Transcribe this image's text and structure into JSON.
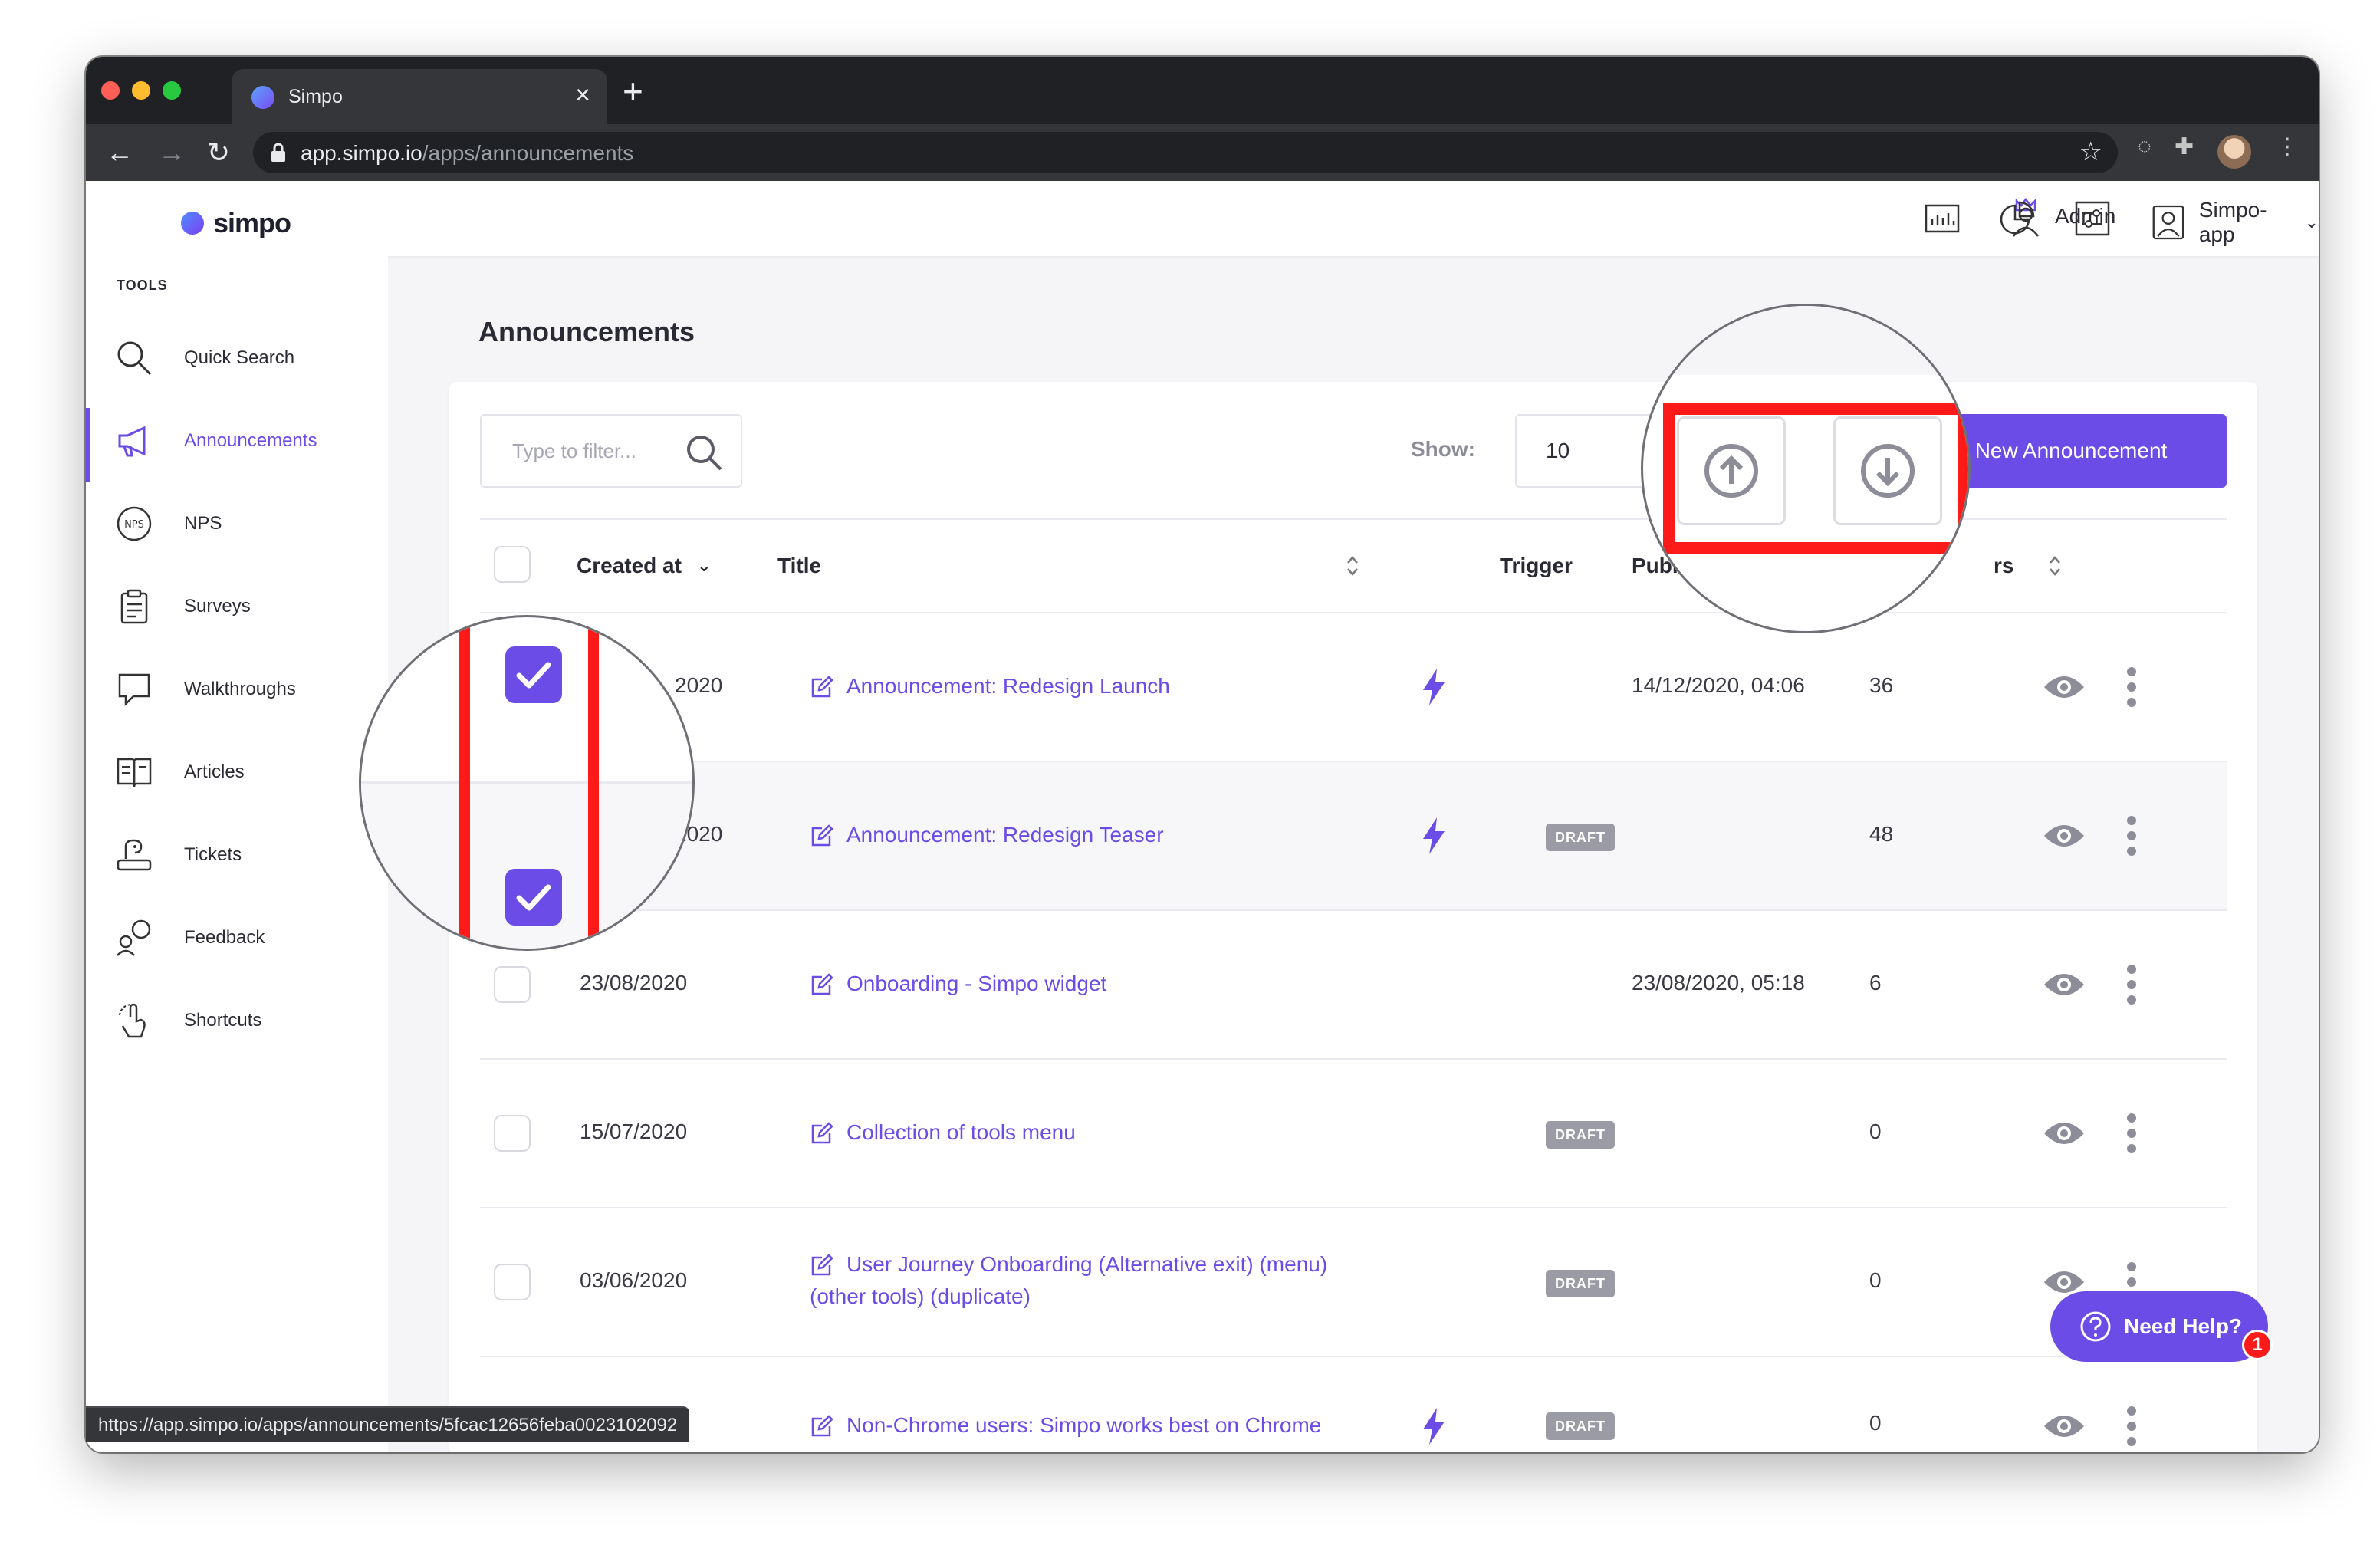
{
  "browser": {
    "tab_title": "Simpo",
    "url_host": "app.simpo.io",
    "url_path": "/apps/announcements",
    "status_url": "https://app.simpo.io/apps/announcements/5fcac12656feba0023102092"
  },
  "sidebar": {
    "logo_text": "simpo",
    "section_label": "TOOLS",
    "items": [
      {
        "label": "Quick Search",
        "icon": "search-icon"
      },
      {
        "label": "Announcements",
        "icon": "megaphone-icon",
        "active": true
      },
      {
        "label": "NPS",
        "icon": "nps-icon"
      },
      {
        "label": "Surveys",
        "icon": "clipboard-icon"
      },
      {
        "label": "Walkthroughs",
        "icon": "speech-bubble-icon"
      },
      {
        "label": "Articles",
        "icon": "book-icon"
      },
      {
        "label": "Tickets",
        "icon": "ticket-icon"
      },
      {
        "label": "Feedback",
        "icon": "feedback-icon"
      },
      {
        "label": "Shortcuts",
        "icon": "shortcut-icon"
      }
    ]
  },
  "topbar": {
    "admin_label": "Admin",
    "app_label": "Simpo-app"
  },
  "page": {
    "title": "Announcements",
    "filter_placeholder": "Type to filter...",
    "show_label": "Show:",
    "show_value": "10",
    "new_button": "New Announcement"
  },
  "table": {
    "headers": {
      "created_at": "Created at",
      "title": "Title",
      "trigger": "Trigger",
      "publish_date": "Publish date",
      "views_partial": "rs"
    },
    "rows": [
      {
        "created": "2020",
        "title": "Announcement: Redesign Launch",
        "title2": "",
        "trigger": true,
        "publish": "14/12/2020, 04:06",
        "draft": "",
        "count": "36"
      },
      {
        "created": "2020",
        "title": "Announcement: Redesign Teaser",
        "title2": "",
        "trigger": true,
        "publish": "",
        "draft": "DRAFT",
        "count": "48"
      },
      {
        "created": "23/08/2020",
        "title": "Onboarding - Simpo widget",
        "title2": "",
        "trigger": false,
        "publish": "23/08/2020, 05:18",
        "draft": "",
        "count": "6"
      },
      {
        "created": "15/07/2020",
        "title": "Collection of tools menu",
        "title2": "",
        "trigger": false,
        "publish": "",
        "draft": "DRAFT",
        "count": "0"
      },
      {
        "created": "03/06/2020",
        "title": "User Journey Onboarding (Alternative exit) (menu)",
        "title2": "(other tools) (duplicate)",
        "trigger": false,
        "publish": "",
        "draft": "DRAFT",
        "count": "0"
      },
      {
        "created": "",
        "title": "Non-Chrome users: Simpo works best on Chrome",
        "title2": "",
        "trigger": true,
        "publish": "",
        "draft": "DRAFT",
        "count": "0"
      }
    ]
  },
  "help": {
    "label": "Need Help?",
    "badge": "1"
  },
  "colors": {
    "accent": "#6b4ce6",
    "highlight_red": "#ff1a1a",
    "draft_badge": "#9b9ba6"
  }
}
